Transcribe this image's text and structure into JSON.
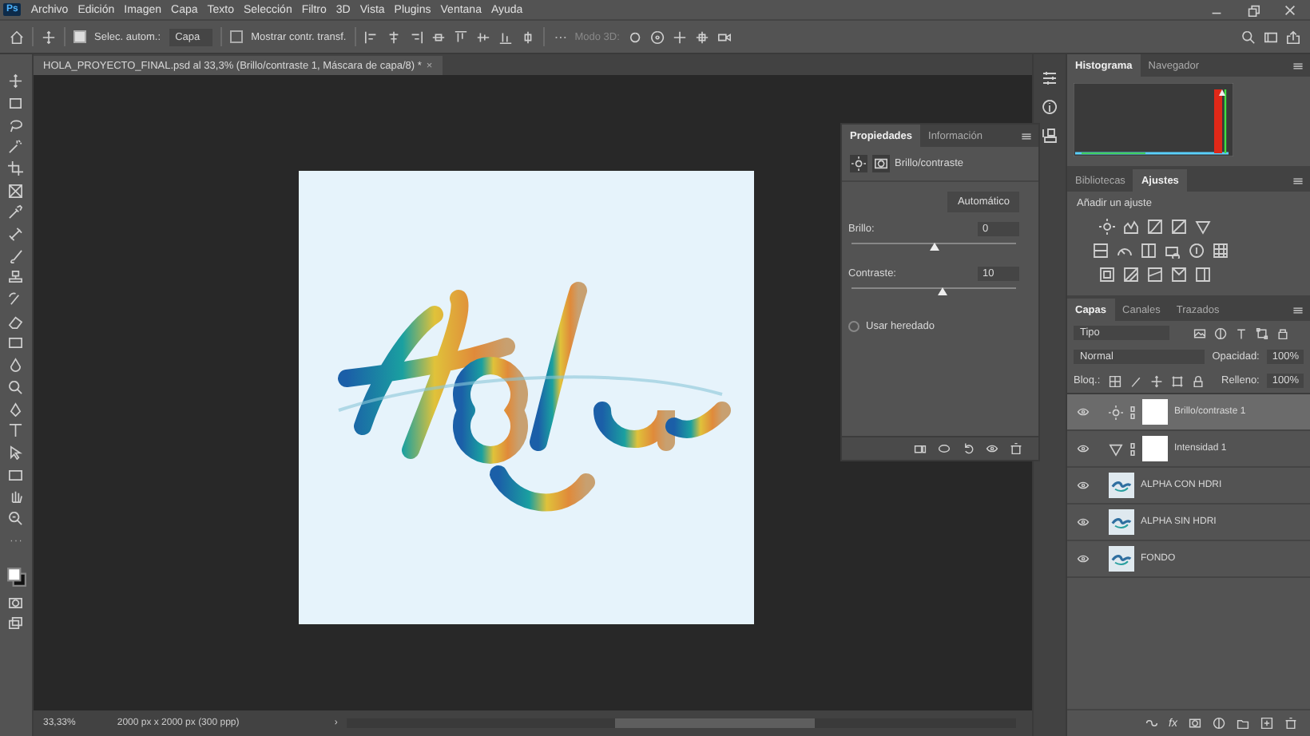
{
  "app_logo": "Ps",
  "menu": [
    "Archivo",
    "Edición",
    "Imagen",
    "Capa",
    "Texto",
    "Selección",
    "Filtro",
    "3D",
    "Vista",
    "Plugins",
    "Ventana",
    "Ayuda"
  ],
  "options_bar": {
    "auto_select": {
      "label": "Selec. autom.:",
      "checked": true
    },
    "target": "Capa",
    "transform_controls": {
      "label": "Mostrar contr. transf.",
      "checked": false
    },
    "mode_3d": "Modo 3D:"
  },
  "document_tab": {
    "title": "HOLA_PROYECTO_FINAL.psd al 33,3% (Brillo/contraste 1, Máscara de capa/8) *",
    "close": "×"
  },
  "properties": {
    "tabs": [
      {
        "label": "Propiedades",
        "selected": true
      },
      {
        "label": "Información",
        "selected": false
      }
    ],
    "adjustment": "Brillo/contraste",
    "auto_button": "Automático",
    "sliders": [
      {
        "label": "Brillo:",
        "value": "0",
        "level": 0.5
      },
      {
        "label": "Contraste:",
        "value": "10",
        "level": 0.55
      }
    ],
    "legacy": {
      "label": "Usar heredado",
      "checked": false
    }
  },
  "histogram_panel": {
    "tabs": [
      {
        "label": "Histograma",
        "selected": true
      },
      {
        "label": "Navegador",
        "selected": false
      }
    ]
  },
  "adjustments_panel": {
    "tabs": [
      {
        "label": "Bibliotecas",
        "selected": false
      },
      {
        "label": "Ajustes",
        "selected": true
      }
    ],
    "heading": "Añadir un ajuste"
  },
  "layers_panel": {
    "tabs": [
      {
        "label": "Capas",
        "selected": true
      },
      {
        "label": "Canales",
        "selected": false
      },
      {
        "label": "Trazados",
        "selected": false
      }
    ],
    "filter": "Tipo",
    "blend_mode": "Normal",
    "opacity": {
      "label": "Opacidad:",
      "value": "100%"
    },
    "lock_label": "Bloq.:",
    "fill": {
      "label": "Relleno:",
      "value": "100%"
    },
    "layers": [
      {
        "name": "Brillo/contraste 1",
        "kind": "brightness",
        "visible": true,
        "selected": true
      },
      {
        "name": "Intensidad 1",
        "kind": "vibrance",
        "visible": true,
        "selected": false
      },
      {
        "name": "ALPHA CON HDRI",
        "kind": "pixel",
        "visible": true,
        "selected": false
      },
      {
        "name": "ALPHA SIN HDRI",
        "kind": "pixel",
        "visible": true,
        "selected": false
      },
      {
        "name": "FONDO",
        "kind": "pixel",
        "visible": true,
        "selected": false
      }
    ],
    "fx_button": "fx"
  },
  "status_bar": {
    "zoom": "33,33%",
    "info": "2000 px x 2000 px (300 ppp)",
    "arrow": "›"
  }
}
